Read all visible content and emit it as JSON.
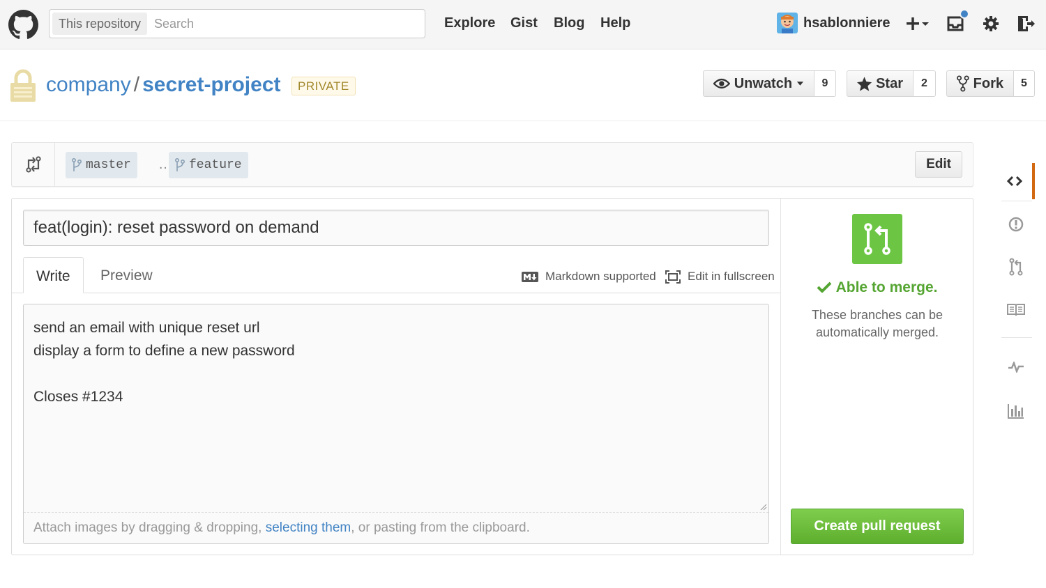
{
  "header": {
    "search_scope": "This repository",
    "search_placeholder": "Search",
    "nav": [
      "Explore",
      "Gist",
      "Blog",
      "Help"
    ],
    "username": "hsablonniere"
  },
  "repo": {
    "owner": "company",
    "separator": "/",
    "name": "secret-project",
    "visibility": "PRIVATE",
    "actions": {
      "watch_label": "Unwatch",
      "watch_count": "9",
      "star_label": "Star",
      "star_count": "2",
      "fork_label": "Fork",
      "fork_count": "5"
    }
  },
  "compare": {
    "base_branch": "master",
    "ellipsis": "…",
    "head_branch": "feature",
    "edit_label": "Edit"
  },
  "pr": {
    "title_value": "feat(login): reset password on demand",
    "tabs": [
      "Write",
      "Preview"
    ],
    "markdown_label": "Markdown supported",
    "fullscreen_label": "Edit in fullscreen",
    "body_value": "send an email with unique reset url\ndisplay a form to define a new password\n\nCloses #1234",
    "attach_prefix": "Attach images by dragging & dropping, ",
    "attach_link": "selecting them",
    "attach_suffix": ", or pasting from the clipboard."
  },
  "merge": {
    "status": "Able to merge.",
    "description": "These branches can be automatically merged.",
    "create_label": "Create pull request"
  },
  "icons": {
    "sidebar": [
      "code-icon",
      "issues-icon",
      "pull-request-icon",
      "wiki-icon",
      "pulse-icon",
      "graphs-icon"
    ]
  },
  "colors": {
    "link": "#4183c4",
    "merge_green": "#6cc644",
    "active_tab_accent": "#d26911"
  }
}
